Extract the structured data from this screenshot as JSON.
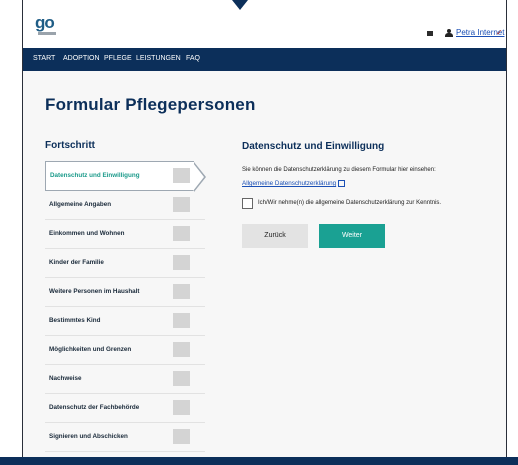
{
  "header": {
    "logo_text": "go",
    "mail_icon": "mail-icon",
    "user_icon": "user-icon",
    "user_name": "Petra Internet",
    "user_menu_icon": "chevron-down-icon"
  },
  "nav": {
    "items": [
      "START",
      "ADOPTION",
      "PFLEGE",
      "LEISTUNGEN",
      "FAQ"
    ]
  },
  "page": {
    "title": "Formular Pflegepersonen"
  },
  "progress": {
    "title": "Fortschritt",
    "steps": [
      {
        "label": "Datenschutz und Einwilligung",
        "active": true
      },
      {
        "label": "Allgemeine Angaben"
      },
      {
        "label": "Einkommen und Wohnen"
      },
      {
        "label": "Kinder der Familie"
      },
      {
        "label": "Weitere Personen im Haushalt"
      },
      {
        "label": "Bestimmtes Kind"
      },
      {
        "label": "Möglichkeiten und Grenzen"
      },
      {
        "label": "Nachweise"
      },
      {
        "label": "Datenschutz der Fachbehörde"
      },
      {
        "label": "Signieren und Abschicken"
      }
    ]
  },
  "content": {
    "section_title": "Datenschutz und Einwilligung",
    "info_text": "Sie können die Datenschutzerklärung zu diesem Formular hier einsehen:",
    "policy_link": "Allgemeine Datenschutzerklärung",
    "checkbox_label": "Ich/Wir nehme(n) die allgemeine Datenschutzerklärung zur Kenntnis.",
    "checkbox_checked": false,
    "back_label": "Zurück",
    "next_label": "Weiter"
  },
  "colors": {
    "navy": "#0c2f5a",
    "accent": "#1aa193",
    "link": "#1a4fb5"
  }
}
